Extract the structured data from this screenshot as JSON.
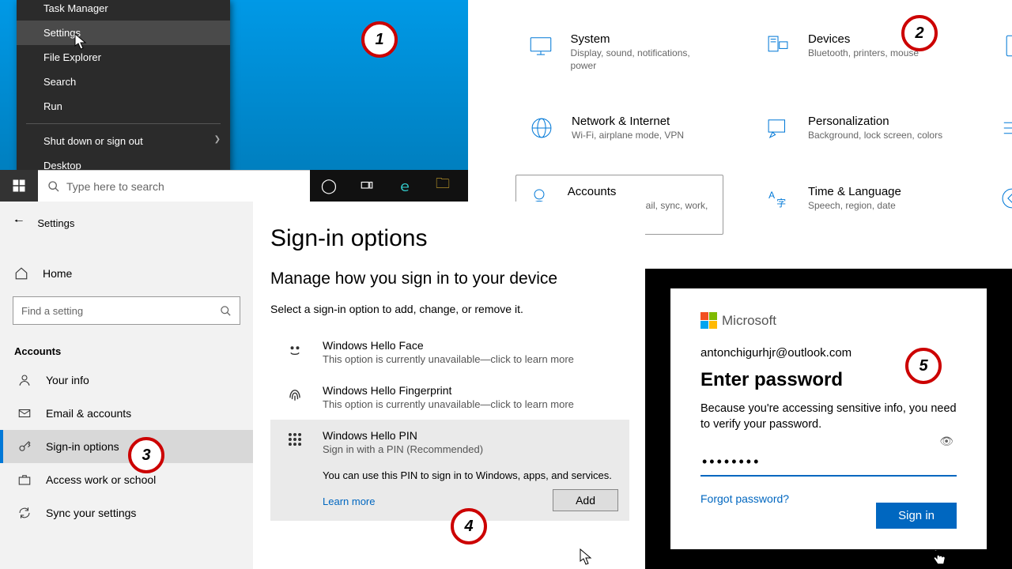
{
  "winx": {
    "items": [
      "Task Manager",
      "Settings",
      "File Explorer",
      "Search",
      "Run",
      "Shut down or sign out",
      "Desktop"
    ],
    "hovered_index": 1
  },
  "taskbar": {
    "search_placeholder": "Type here to search"
  },
  "settings_home": {
    "cats": [
      {
        "title": "System",
        "sub": "Display, sound, notifications, power"
      },
      {
        "title": "Devices",
        "sub": "Bluetooth, printers, mouse"
      },
      {
        "title": "Network & Internet",
        "sub": "Wi-Fi, airplane mode, VPN"
      },
      {
        "title": "Personalization",
        "sub": "Background, lock screen, colors"
      },
      {
        "title": "Accounts",
        "sub": "Your accounts, email, sync, work, family"
      },
      {
        "title": "Time & Language",
        "sub": "Speech, region, date"
      }
    ],
    "selected_index": 4
  },
  "settings_page": {
    "back_label": "Settings",
    "home_label": "Home",
    "search_placeholder": "Find a setting",
    "section": "Accounts",
    "nav": [
      "Your info",
      "Email & accounts",
      "Sign-in options",
      "Access work or school",
      "Sync your settings"
    ],
    "nav_active_index": 2,
    "title": "Sign-in options",
    "subtitle": "Manage how you sign in to your device",
    "instruction": "Select a sign-in option to add, change, or remove it.",
    "options": [
      {
        "t": "Windows Hello Face",
        "s": "This option is currently unavailable—click to learn more"
      },
      {
        "t": "Windows Hello Fingerprint",
        "s": "This option is currently unavailable—click to learn more"
      },
      {
        "t": "Windows Hello PIN",
        "s": "Sign in with a PIN (Recommended)"
      }
    ],
    "pin_detail": "You can use this PIN to sign in to Windows, apps, and services.",
    "learn_more": "Learn more",
    "add_button": "Add"
  },
  "ms_dialog": {
    "brand": "Microsoft",
    "account": "antonchigurhjr@outlook.com",
    "heading": "Enter password",
    "reason": "Because you're accessing sensitive info, you need to verify your password.",
    "password_mask": "●●●●●●●●",
    "forgot": "Forgot password?",
    "signin": "Sign in"
  },
  "badges": {
    "1": "1",
    "2": "2",
    "3": "3",
    "4": "4",
    "5": "5"
  }
}
